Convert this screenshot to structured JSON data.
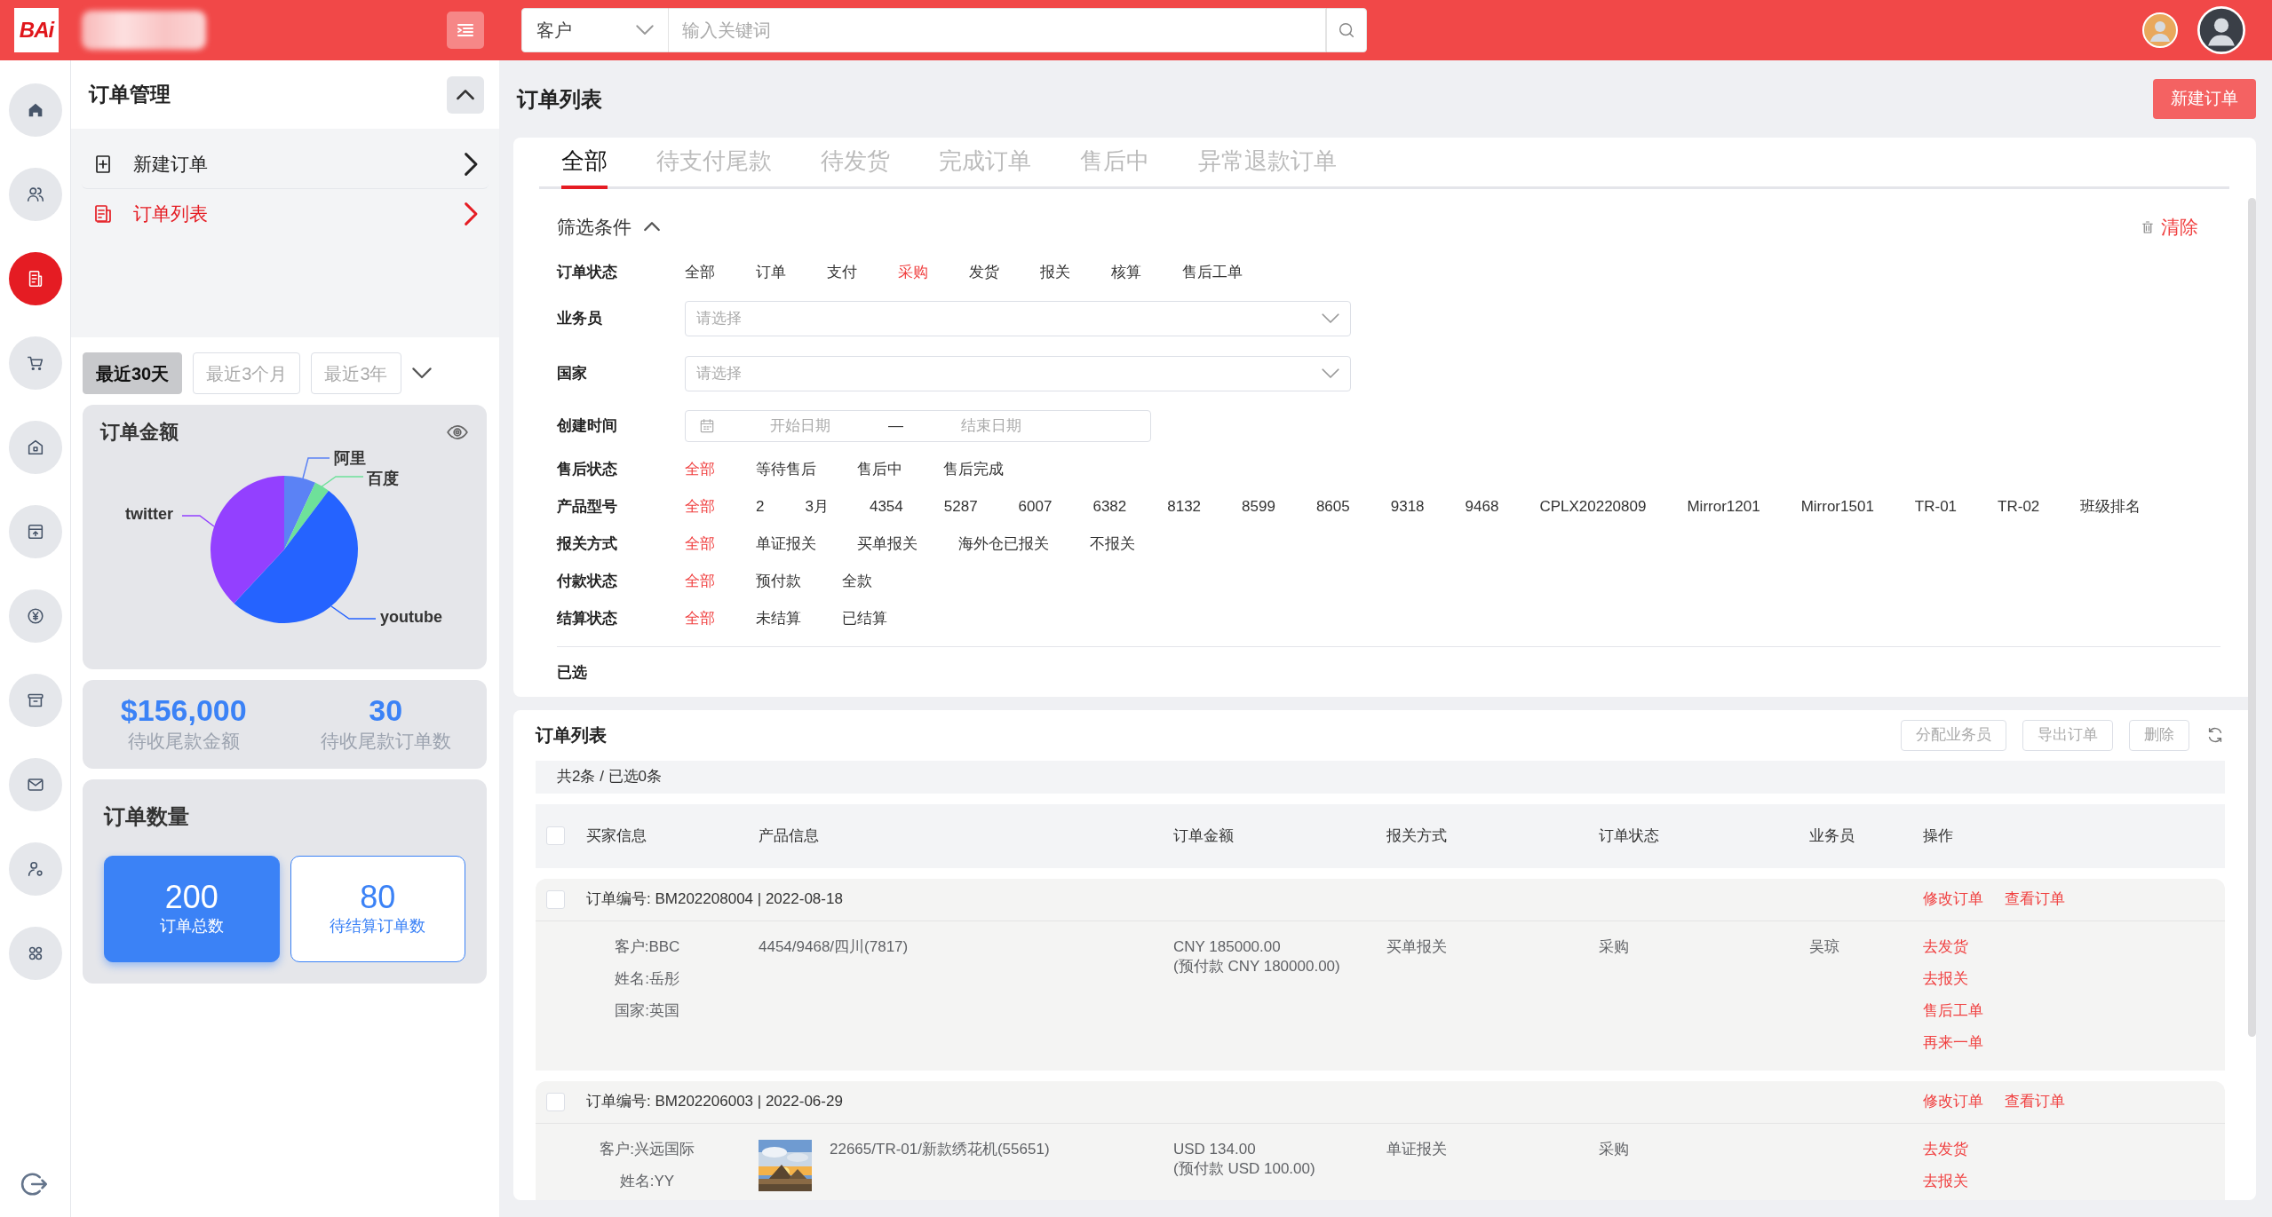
{
  "topbar": {
    "logo": "BAi",
    "search_scope": "客户",
    "search_placeholder": "输入关键词"
  },
  "rail": [
    {
      "kind": "home",
      "selected": false
    },
    {
      "kind": "users",
      "selected": false
    },
    {
      "kind": "document",
      "selected": true
    },
    {
      "kind": "cart",
      "selected": false
    },
    {
      "kind": "house",
      "selected": false
    },
    {
      "kind": "upload-box",
      "selected": false
    },
    {
      "kind": "yen",
      "selected": false
    },
    {
      "kind": "archive",
      "selected": false
    },
    {
      "kind": "mail",
      "selected": false
    },
    {
      "kind": "user-gear",
      "selected": false
    },
    {
      "kind": "grid",
      "selected": false
    }
  ],
  "rail_bottom": {
    "kind": "logout"
  },
  "submenu": {
    "title": "订单管理",
    "items": [
      {
        "label": "新建订单",
        "kind": "add",
        "selected": false
      },
      {
        "label": "订单列表",
        "kind": "list",
        "selected": true
      }
    ]
  },
  "periods": [
    {
      "label": "最近30天",
      "selected": true
    },
    {
      "label": "最近3个月",
      "selected": false
    },
    {
      "label": "最近3年",
      "selected": false
    }
  ],
  "amount_card": {
    "title": "订单金额",
    "slices": [
      {
        "label": "阿里",
        "color": "#5b82f5"
      },
      {
        "label": "百度",
        "color": "#6ee19a"
      },
      {
        "label": "youtube",
        "color": "#2563ff"
      },
      {
        "label": "twitter",
        "color": "#9340ff"
      }
    ]
  },
  "stats": [
    {
      "value": "$156,000",
      "label": "待收尾款金额"
    },
    {
      "value": "30",
      "label": "待收尾款订单数"
    }
  ],
  "count_card": {
    "title": "订单数量",
    "tiles": [
      {
        "value": "200",
        "label": "订单总数",
        "selected": true
      },
      {
        "value": "80",
        "label": "待结算订单数",
        "selected": false
      }
    ]
  },
  "page_title": "订单列表",
  "new_order_button": "新建订单",
  "tabs": [
    {
      "label": "全部",
      "selected": true
    },
    {
      "label": "待支付尾款",
      "selected": false
    },
    {
      "label": "待发货",
      "selected": false
    },
    {
      "label": "完成订单",
      "selected": false
    },
    {
      "label": "售后中",
      "selected": false
    },
    {
      "label": "异常退款订单",
      "selected": false
    }
  ],
  "filters": {
    "title": "筛选条件",
    "clear": "清除",
    "selected_label": "已选",
    "rows": [
      {
        "label": "订单状态",
        "kind": "options",
        "options": [
          {
            "label": "全部",
            "selected": false
          },
          {
            "label": "订单",
            "selected": false
          },
          {
            "label": "支付",
            "selected": false
          },
          {
            "label": "采购",
            "selected": true
          },
          {
            "label": "发货",
            "selected": false
          },
          {
            "label": "报关",
            "selected": false
          },
          {
            "label": "核算",
            "selected": false
          },
          {
            "label": "售后工单",
            "selected": false
          }
        ]
      },
      {
        "label": "业务员",
        "kind": "select",
        "placeholder": "请选择"
      },
      {
        "label": "国家",
        "kind": "select",
        "placeholder": "请选择"
      },
      {
        "label": "创建时间",
        "kind": "daterange",
        "start": {
          "placeholder": "开始日期"
        },
        "separator": "—",
        "end": {
          "placeholder": "结束日期"
        }
      },
      {
        "label": "售后状态",
        "kind": "options",
        "options": [
          {
            "label": "全部",
            "selected": true
          },
          {
            "label": "等待售后",
            "selected": false
          },
          {
            "label": "售后中",
            "selected": false
          },
          {
            "label": "售后完成",
            "selected": false
          }
        ]
      },
      {
        "label": "产品型号",
        "kind": "options",
        "options": [
          {
            "label": "全部",
            "selected": true
          },
          {
            "label": "2",
            "selected": false
          },
          {
            "label": "3月",
            "selected": false
          },
          {
            "label": "4354",
            "selected": false
          },
          {
            "label": "5287",
            "selected": false
          },
          {
            "label": "6007",
            "selected": false
          },
          {
            "label": "6382",
            "selected": false
          },
          {
            "label": "8132",
            "selected": false
          },
          {
            "label": "8599",
            "selected": false
          },
          {
            "label": "8605",
            "selected": false
          },
          {
            "label": "9318",
            "selected": false
          },
          {
            "label": "9468",
            "selected": false
          },
          {
            "label": "CPLX20220809",
            "selected": false
          },
          {
            "label": "Mirror1201",
            "selected": false
          },
          {
            "label": "Mirror1501",
            "selected": false
          },
          {
            "label": "TR-01",
            "selected": false
          },
          {
            "label": "TR-02",
            "selected": false
          },
          {
            "label": "班级排名",
            "selected": false
          }
        ]
      },
      {
        "label": "报关方式",
        "kind": "options",
        "options": [
          {
            "label": "全部",
            "selected": true
          },
          {
            "label": "单证报关",
            "selected": false
          },
          {
            "label": "买单报关",
            "selected": false
          },
          {
            "label": "海外仓已报关",
            "selected": false
          },
          {
            "label": "不报关",
            "selected": false
          }
        ]
      },
      {
        "label": "付款状态",
        "kind": "options",
        "options": [
          {
            "label": "全部",
            "selected": true
          },
          {
            "label": "预付款",
            "selected": false
          },
          {
            "label": "全款",
            "selected": false
          }
        ]
      },
      {
        "label": "结算状态",
        "kind": "options",
        "options": [
          {
            "label": "全部",
            "selected": true
          },
          {
            "label": "未结算",
            "selected": false
          },
          {
            "label": "已结算",
            "selected": false
          }
        ]
      }
    ]
  },
  "orders": {
    "title": "订单列表",
    "actions": [
      "分配业务员",
      "导出订单",
      "删除"
    ],
    "summary": "共2条 / 已选0条",
    "header_checked": false,
    "columns": [
      "买家信息",
      "产品信息",
      "订单金额",
      "报关方式",
      "订单状态",
      "业务员",
      "操作"
    ],
    "rows": [
      {
        "checked": false,
        "header": "订单编号: BM202208004 | 2022-08-18",
        "header_actions": [
          "修改订单",
          "查看订单"
        ],
        "buyer": [
          "客户:BBC",
          "姓名:岳彤",
          "国家:英国"
        ],
        "product": {
          "image": false,
          "text": "4454/9468/四川(7817)"
        },
        "amount": [
          "CNY 185000.00",
          "(预付款 CNY 180000.00)"
        ],
        "customs": "买单报关",
        "status": "采购",
        "salesperson": "吴琼",
        "actions": [
          "去发货",
          "去报关",
          "售后工单",
          "再来一单"
        ]
      },
      {
        "checked": false,
        "header": "订单编号: BM202206003 | 2022-06-29",
        "header_actions": [
          "修改订单",
          "查看订单"
        ],
        "buyer": [
          "客户:兴远国际",
          "姓名:YY"
        ],
        "product": {
          "image": true,
          "text": "22665/TR-01/新款绣花机(55651)"
        },
        "amount": [
          "USD 134.00",
          "(预付款 USD 100.00)"
        ],
        "customs": "单证报关",
        "status": "采购",
        "actions": [
          "去发货",
          "去报关"
        ]
      }
    ]
  }
}
